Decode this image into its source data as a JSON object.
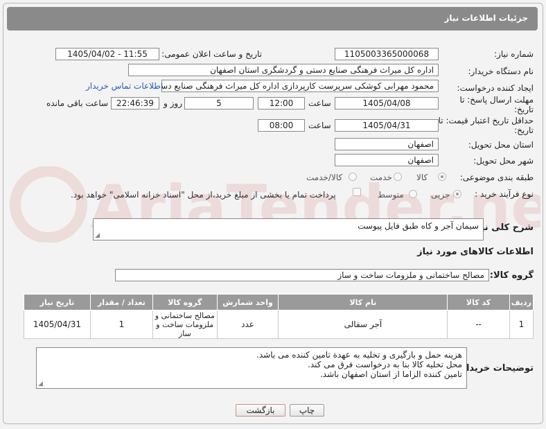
{
  "header": {
    "title": "جزئیات اطلاعات نیاز"
  },
  "fields": {
    "need_number_label": "شماره نیاز:",
    "need_number": "1105003365000068",
    "announce_label": "تاریخ و ساعت اعلان عمومی:",
    "announce_value": "1405/04/02 - 11:55",
    "buyer_org_label": "نام دستگاه خریدار:",
    "buyer_org": "اداره کل میراث فرهنگی  صنایع دستی و گردشگری استان اصفهان",
    "creator_label": "ایجاد کننده درخواست:",
    "creator": "محمود مهرابی کوشکی سرپرست کارپردازی اداره کل میراث فرهنگی  صنایع دستی",
    "contact_link": "اطلاعات تماس خریدار",
    "reply_deadline_label": "مهلت ارسال پاسخ: تا تاریخ:",
    "reply_date": "1405/04/08",
    "time_label": "ساعت",
    "reply_time": "12:00",
    "days_value": "5",
    "days_label": "روز و",
    "remaining_time": "22:46:39",
    "remaining_label": "ساعت باقی مانده",
    "price_validity_label": "حداقل تاریخ اعتبار قیمت: تا تاریخ:",
    "price_date": "1405/04/31",
    "price_time": "08:00",
    "province_label": "استان محل تحویل:",
    "province": "اصفهان",
    "city_label": "شهر محل تحویل:",
    "city": "اصفهان",
    "category_label": "طبقه بندی موضوعی:",
    "category_options": [
      "کالا",
      "خدمت",
      "کالا/خدمت"
    ],
    "process_label": "نوع فرآیند خرید :",
    "process_options": [
      "جزیی",
      "متوسط"
    ],
    "payment_note": "پرداخت تمام یا بخشی از مبلغ خرید،از محل \"اسناد خزانه اسلامی\" خواهد بود.",
    "summary_label": "شرح کلی نیاز:",
    "summary": "سیمان آجر و کاه طبق فایل پیوست",
    "goods_info_title": "اطلاعات کالاهای مورد نیاز",
    "goods_group_label": "گروه کالا:",
    "goods_group": "مصالح ساختمانی و ملزومات ساخت و ساز",
    "buyer_notes_label": "توضیحات خریدار:",
    "buyer_notes": [
      "هزینه حمل و بارگیری و تخلیه به عهدة تامین کننده می باشد.",
      "محل تخلیه کالا بنا به درخواست فرق می کند.",
      "تامین کننده الزاما از استان اصفهان باشد."
    ]
  },
  "table": {
    "headers": [
      "ردیف",
      "کد کالا",
      "نام کالا",
      "واحد شمارش",
      "گروه کالا",
      "تعداد / مقدار",
      "تاریخ نیاز"
    ],
    "rows": [
      [
        "1",
        "--",
        "آجر سفالی",
        "عدد",
        "مصالح ساختمانی و ملزومات ساخت و ساز",
        "1",
        "1405/04/31"
      ]
    ]
  },
  "buttons": {
    "print": "چاپ",
    "back": "بازگشت"
  },
  "watermark": {
    "text": "AriaTender.net"
  },
  "colors": {
    "header_bg": "#8a8a8a",
    "link": "#2a5db0",
    "back_button_border": "#d08a8a"
  }
}
